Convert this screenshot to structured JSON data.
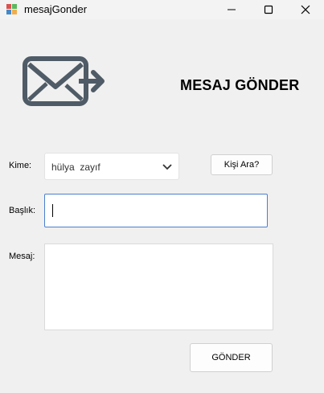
{
  "window": {
    "title": "mesajGonder"
  },
  "header": {
    "title": "MESAJ GÖNDER",
    "icon": "mail-send-icon"
  },
  "form": {
    "to_label": "Kime:",
    "to_value": "hülya  zayıf",
    "search_button": "Kişi Ara?",
    "subject_label": "Başlık:",
    "subject_value": "",
    "message_label": "Mesaj:",
    "message_value": "",
    "send_button": "GÖNDER"
  },
  "colors": {
    "icon": "#4f5b66",
    "focus_border": "#4a7fd0",
    "background": "#f0f0f0"
  }
}
